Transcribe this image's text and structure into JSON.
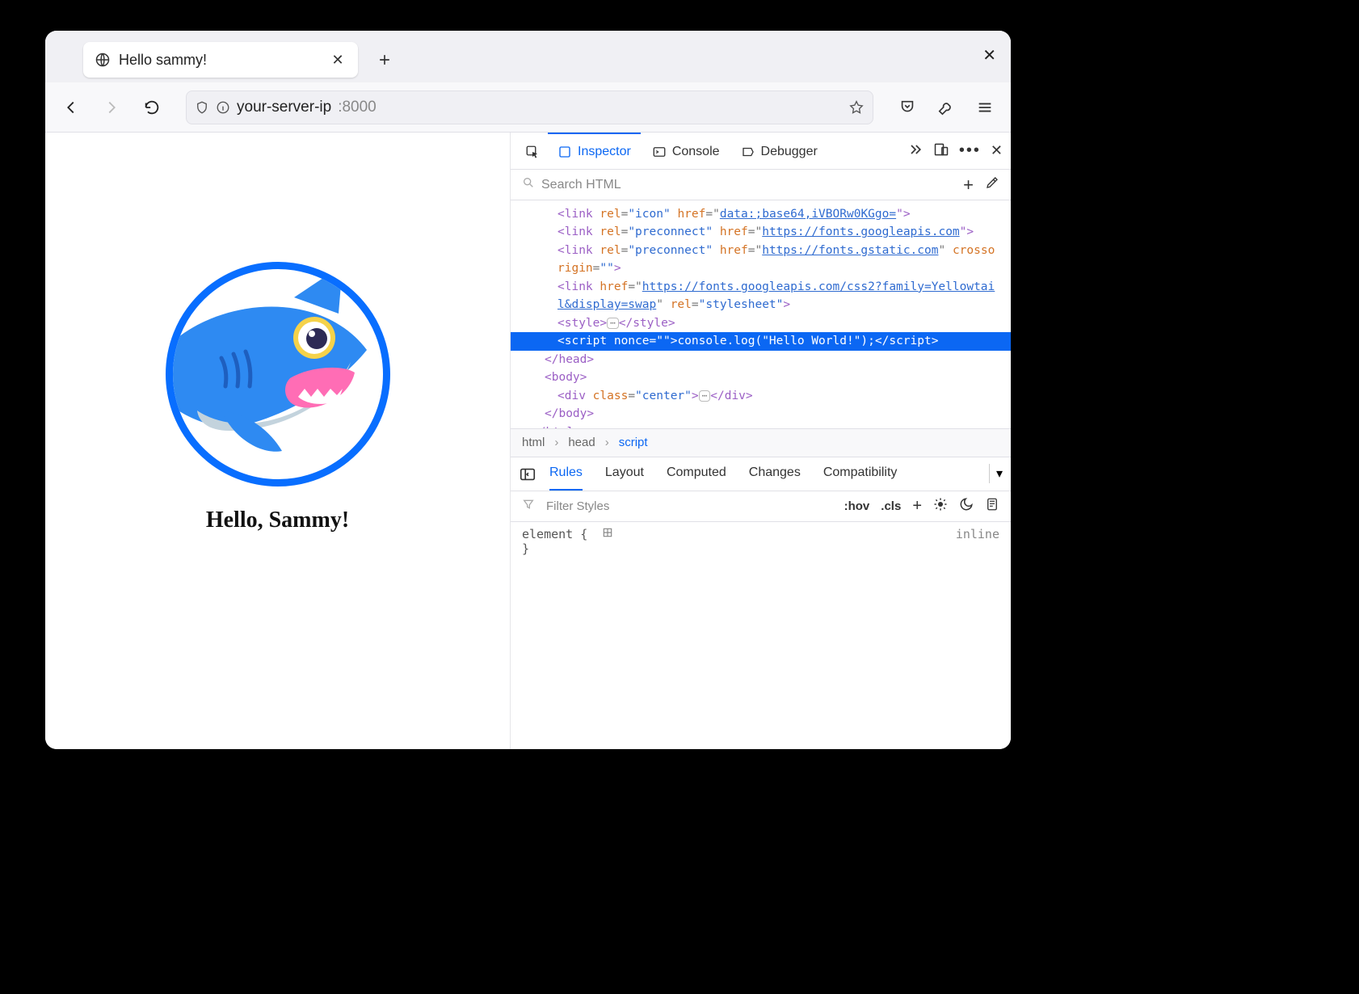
{
  "browser": {
    "tab_title": "Hello sammy!",
    "url_host": "your-server-ip",
    "url_port": ":8000"
  },
  "page": {
    "heading": "Hello, Sammy!"
  },
  "devtools": {
    "tabs": {
      "inspector": "Inspector",
      "console": "Console",
      "debugger": "Debugger"
    },
    "search_placeholder": "Search HTML",
    "html_lines": {
      "l1a": "<link",
      "l1_rel": "rel",
      "l1_relv": "\"icon\"",
      "l1_href": "href",
      "l1b": "\"",
      "l1_url": "data:;base64,iVBORw0KGgo=",
      "l1c": "\">",
      "l2a": "<link",
      "l2_rel": "rel",
      "l2_relv": "\"preconnect\"",
      "l2_href": "href",
      "l2b": "\"",
      "l2_url": "https://fonts.googleapis.com",
      "l2c": "\">",
      "l3a": "<link",
      "l3_rel": "rel",
      "l3_relv": "\"preconnect\"",
      "l3_href": "href",
      "l3b": "\"",
      "l3_url": "https://fonts.gstatic.com",
      "l3c": "\"",
      "l3_cross": "crossorigin",
      "l3_crossv": "\"\"",
      "l3d": ">",
      "l4a": "<link",
      "l4_href": "href",
      "l4b": "\"",
      "l4_url": "https://fonts.googleapis.com/css2?family=Yellowtail&display=swap",
      "l4c": "\"",
      "l4_rel": "rel",
      "l4_relv": "\"stylesheet\"",
      "l4d": ">",
      "l5a": "<style>",
      "l5b": "</style>",
      "l6a": "<script",
      "l6_nonce": "nonce",
      "l6_noncev": "\"\"",
      "l6b": ">",
      "l6_txt": "console.log(\"Hello World!\");",
      "l6c": "</script>",
      "l7": "</head>",
      "l8a": "<body>",
      "l9a": "<div",
      "l9_cls": "class",
      "l9_clsv": "\"center\"",
      "l9b": ">",
      "l9c": "</div>",
      "l10": "</body>",
      "l11": "</html>"
    },
    "breadcrumbs": {
      "a": "html",
      "b": "head",
      "c": "script"
    },
    "rules_tabs": {
      "rules": "Rules",
      "layout": "Layout",
      "computed": "Computed",
      "changes": "Changes",
      "compat": "Compatibility"
    },
    "filter_placeholder": "Filter Styles",
    "filter_hov": ":hov",
    "filter_cls": ".cls",
    "rules_element": "element {",
    "rules_close": "}",
    "rules_inline": "inline"
  }
}
